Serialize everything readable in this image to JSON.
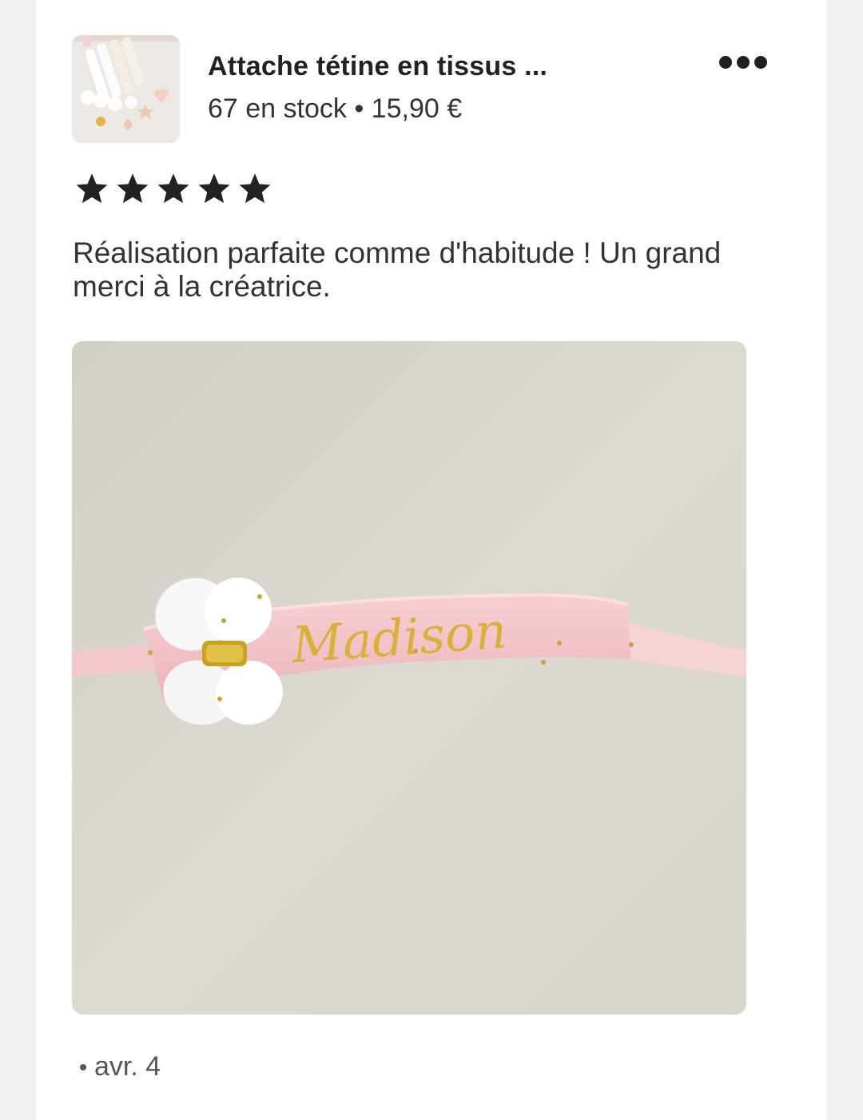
{
  "listing": {
    "title": "Attache tétine en tissus ...",
    "meta": "67 en stock • 15,90 €",
    "thumbnail_icon": "product-thumbnail"
  },
  "review": {
    "rating": 5,
    "max_rating": 5,
    "text": "Réalisation parfaite comme d'habitude ! Un grand merci à la créatrice.",
    "photo_icon": "review-photo",
    "photo_embroidered_text": "Madison",
    "date": "avr. 4"
  },
  "colors": {
    "background": "#f0f0f0",
    "card": "#ffffff",
    "star": "#222222",
    "text": "#333333"
  }
}
